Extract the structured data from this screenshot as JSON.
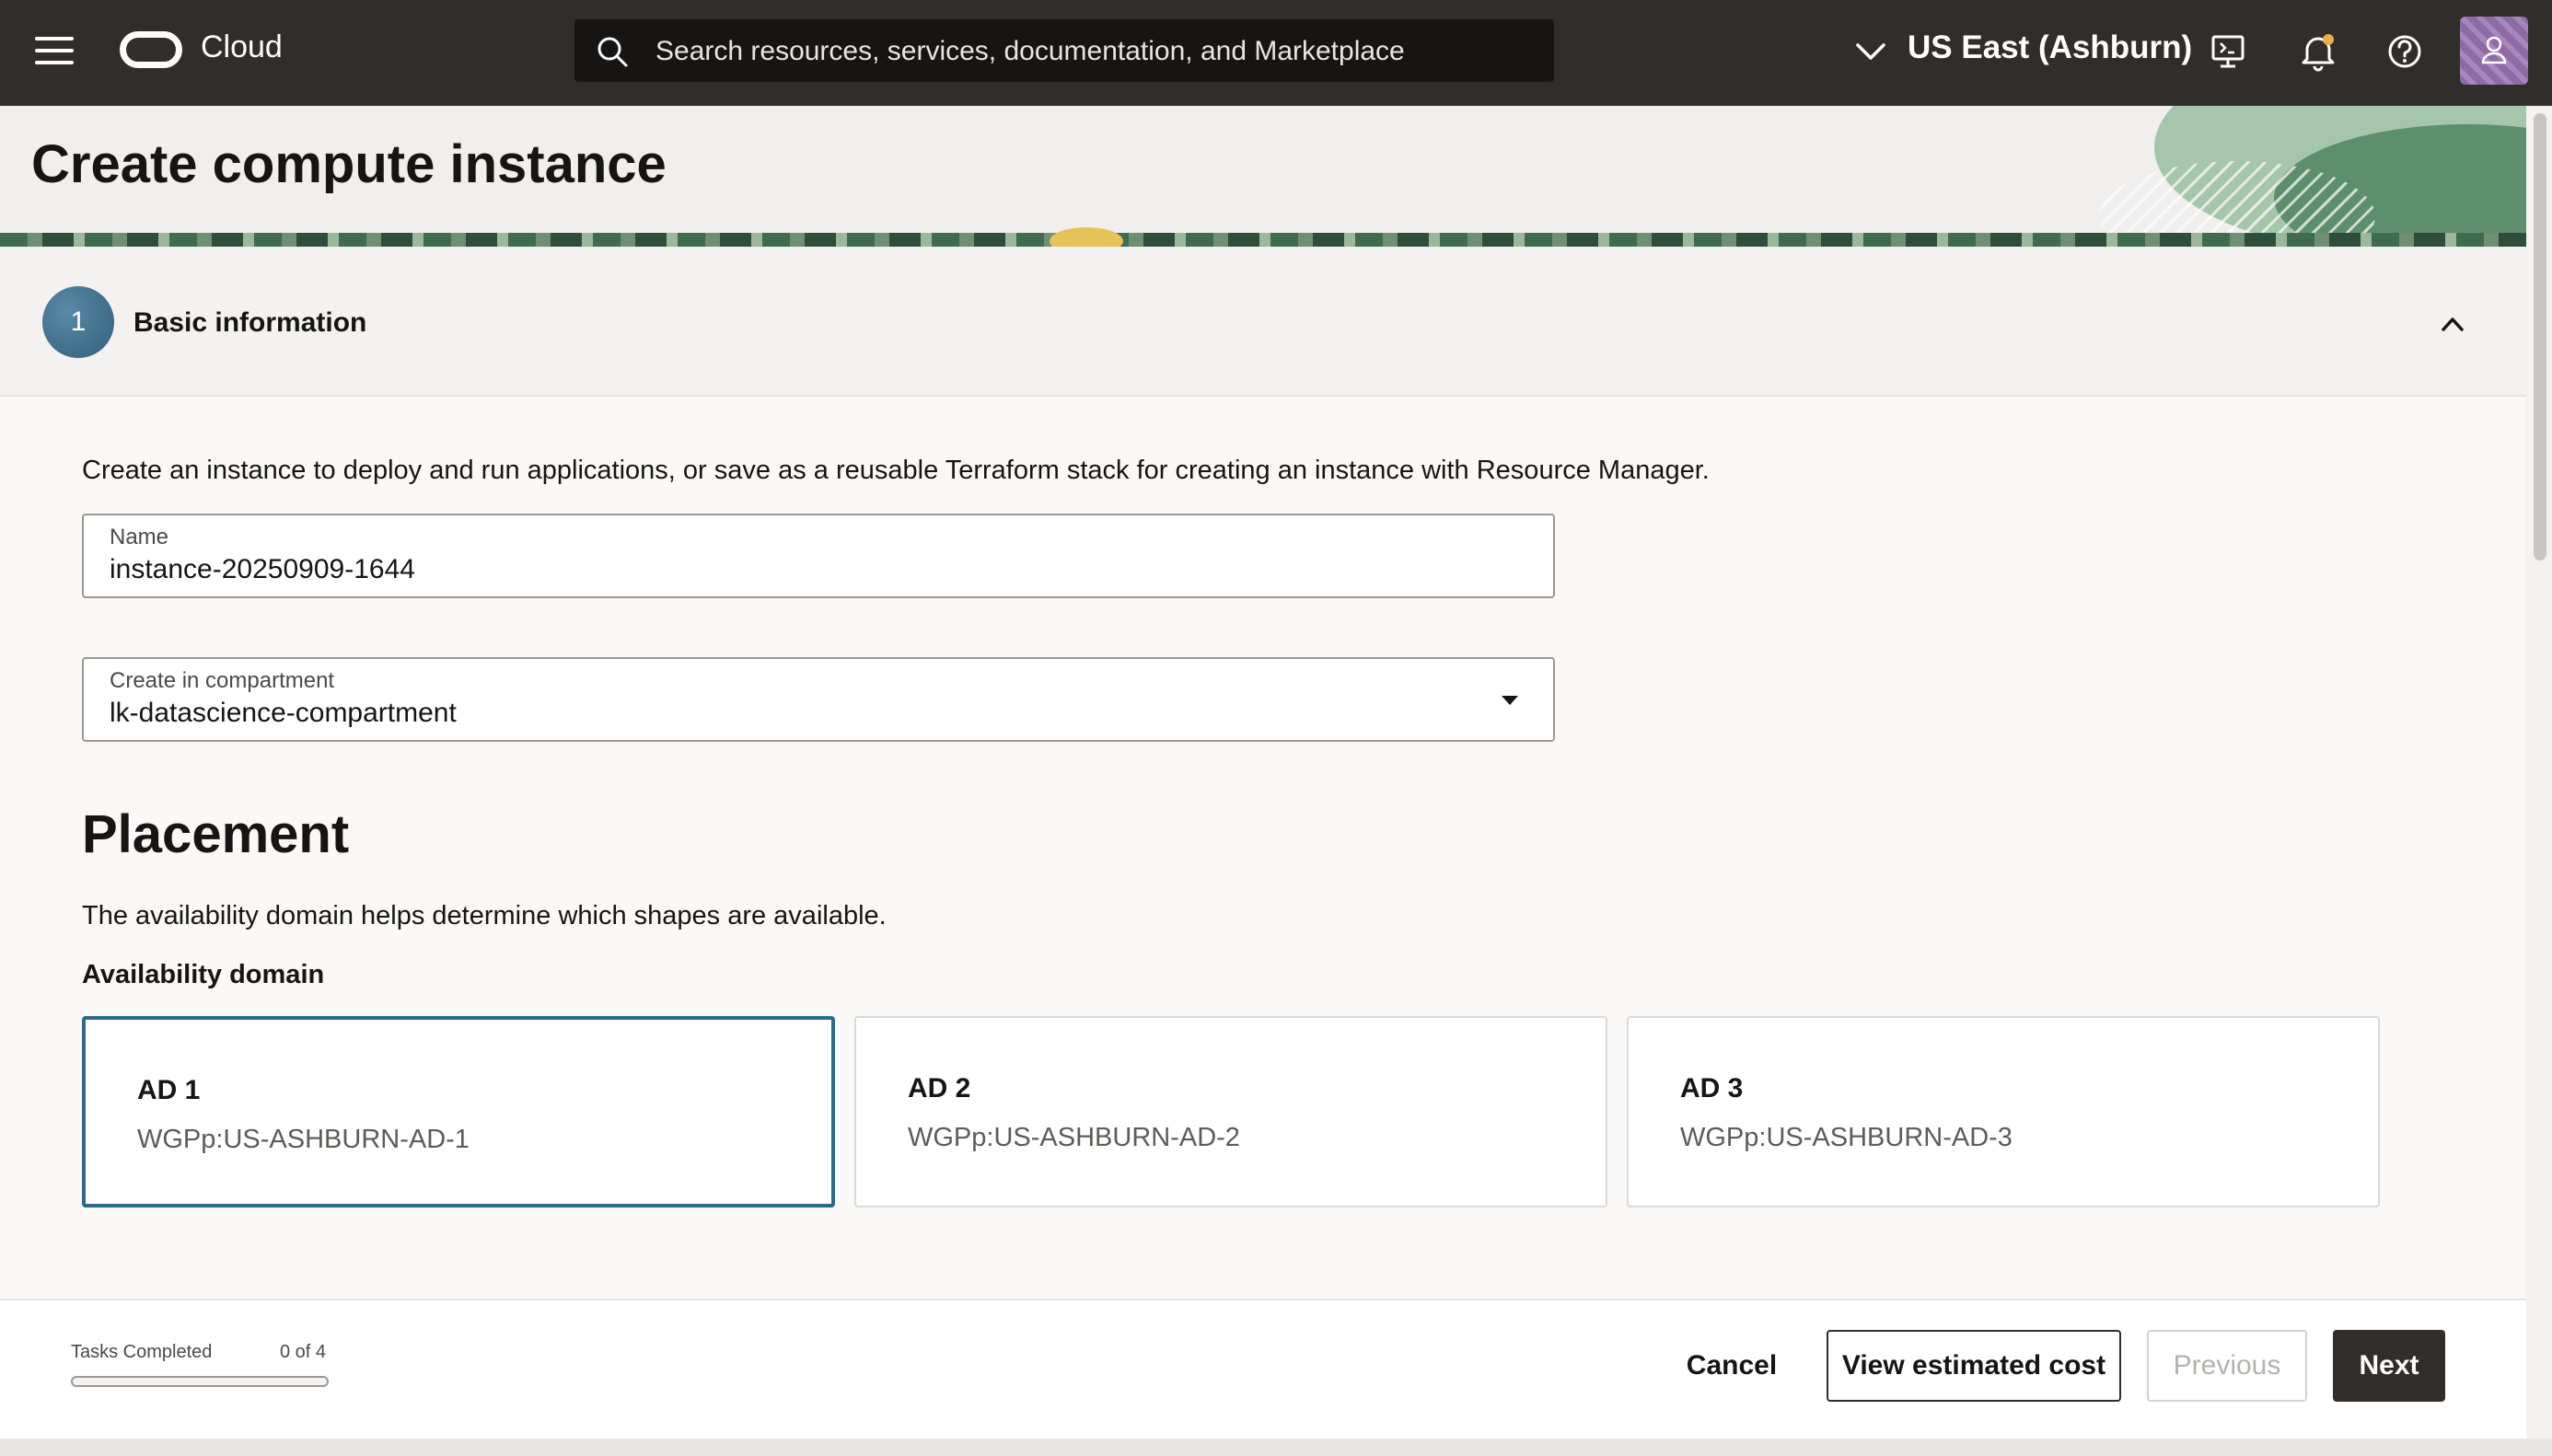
{
  "topbar": {
    "brand": "Cloud",
    "search_placeholder": "Search resources, services, documentation, and Marketplace",
    "region": "US East (Ashburn)"
  },
  "page": {
    "title": "Create compute instance"
  },
  "step": {
    "number": "1",
    "title": "Basic information"
  },
  "form": {
    "intro": "Create an instance to deploy and run applications, or save as a reusable Terraform stack for creating an instance with Resource Manager.",
    "name_label": "Name",
    "name_value": "instance-20250909-1644",
    "compartment_label": "Create in compartment",
    "compartment_value": "lk-datascience-compartment"
  },
  "placement": {
    "title": "Placement",
    "description": "The availability domain helps determine which shapes are available.",
    "ad_label": "Availability domain",
    "domains": [
      {
        "name": "AD 1",
        "id": "WGPp:US-ASHBURN-AD-1",
        "selected": true
      },
      {
        "name": "AD 2",
        "id": "WGPp:US-ASHBURN-AD-2",
        "selected": false
      },
      {
        "name": "AD 3",
        "id": "WGPp:US-ASHBURN-AD-3",
        "selected": false
      }
    ]
  },
  "footer": {
    "tasks_label": "Tasks Completed",
    "tasks_count": "0 of 4",
    "tasks_progress_percent": 0,
    "cancel": "Cancel",
    "view_cost": "View estimated cost",
    "previous": "Previous",
    "next": "Next"
  },
  "colors": {
    "topbar": "#312d2a",
    "accent": "#2c6a8a",
    "primary_button": "#312d2a"
  },
  "icons": {
    "menu": "hamburger-menu-icon",
    "logo": "oracle-cloud-logo",
    "search": "search-icon",
    "region_dropdown": "chevron-down-icon",
    "cloud_shell": "cloud-shell-icon",
    "notifications": "bell-icon",
    "help": "help-icon",
    "profile": "user-avatar-icon",
    "collapse": "chevron-up-icon",
    "dropdown": "caret-down-icon"
  }
}
